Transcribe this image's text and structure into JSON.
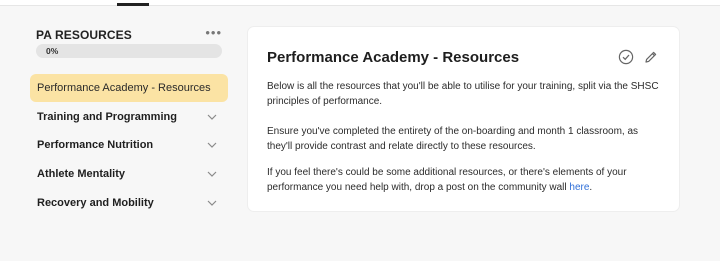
{
  "sidebar": {
    "title": "PA RESOURCES",
    "more_icon": "more-dots-icon",
    "progress": {
      "label": "0%",
      "value": 0
    },
    "items": [
      {
        "label": "Performance Academy - Resources",
        "active": true
      },
      {
        "label": "Training and Programming",
        "icon": "chevron-down-icon"
      },
      {
        "label": "Performance Nutrition",
        "icon": "chevron-down-icon"
      },
      {
        "label": "Athlete Mentality",
        "icon": "chevron-down-icon"
      },
      {
        "label": "Recovery and Mobility",
        "icon": "chevron-down-icon"
      }
    ]
  },
  "main": {
    "title": "Performance Academy - Resources",
    "icons": [
      "check-circle-icon",
      "pencil-icon"
    ],
    "paragraphs": [
      "Below is all the resources that you'll be able to utilise for your training, split via the SHSC principles of performance.",
      "Ensure you've completed the entirety of the on-boarding and month 1 classroom, as they'll provide contrast and relate directly to these resources.",
      "If you feel there's could be some additional resources, or there's elements of your performance you need help with, drop a post on the community wall"
    ],
    "link_text": "here",
    "trailing": "."
  },
  "colors": {
    "active_bg": "#fbe3a4",
    "link": "#2f6fd8",
    "progress_track": "#e4e4e4"
  }
}
